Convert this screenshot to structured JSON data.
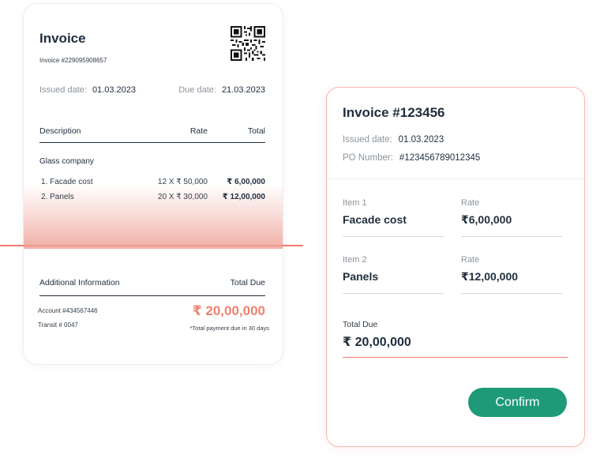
{
  "invoice_card": {
    "title": "Invoice",
    "invoice_number": "Invoice #229095908657",
    "issued_label": "Issued date:",
    "issued_value": "01.03.2023",
    "due_label": "Due date:",
    "due_value": "21.03.2023",
    "columns": {
      "description": "Description",
      "rate": "Rate",
      "total": "Total"
    },
    "company": "Glass company",
    "items": [
      {
        "description": "1. Facade cost",
        "rate": "12 X ₹ 50,000",
        "total": "₹ 6,00,000"
      },
      {
        "description": "2. Panels",
        "rate": "20 X ₹ 30,000",
        "total": "₹ 12,00,000"
      }
    ],
    "additional_label": "Additional Information",
    "total_due_label": "Total Due",
    "account": "Account #434567446",
    "transit": "Transit # 0047",
    "total_due_value": "₹ 20,00,000",
    "note": "*Total payment due in 30 days",
    "qr_icon": "qr-code-icon"
  },
  "form_card": {
    "title": "Invoice #123456",
    "issued_label": "Issued date:",
    "issued_value": "01.03.2023",
    "po_label": "PO Number:",
    "po_value": "#123456789012345",
    "items": [
      {
        "item_label": "Item 1",
        "item_value": "Facade cost",
        "rate_label": "Rate",
        "rate_value": "₹6,00,000"
      },
      {
        "item_label": "Item 2",
        "item_value": "Panels",
        "rate_label": "Rate",
        "rate_value": "₹12,00,000"
      }
    ],
    "total_due_label": "Total Due",
    "total_due_value": "₹ 20,00,000",
    "confirm_label": "Confirm"
  },
  "colors": {
    "accent": "#ef7d6d",
    "button": "#1f9a79",
    "text": "#1f2d3d",
    "muted": "#8c949c"
  }
}
